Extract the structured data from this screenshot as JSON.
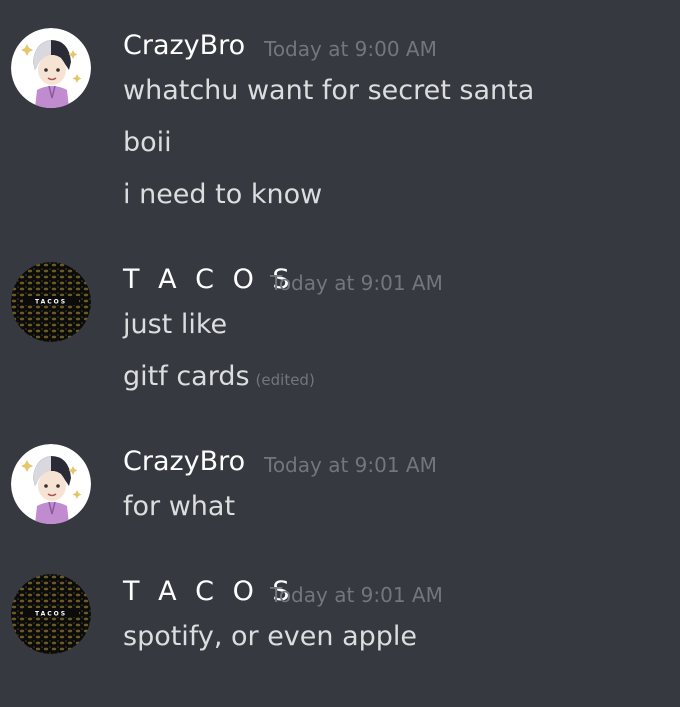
{
  "messages": [
    {
      "author": "CrazyBro",
      "timestamp": "Today at 9:00 AM",
      "lines": [
        {
          "text": "whatchu want for secret santa"
        },
        {
          "text": "boii"
        },
        {
          "text": "i need to know"
        }
      ]
    },
    {
      "author": "T A C O S",
      "timestamp": "Today at 9:01 AM",
      "lines": [
        {
          "text": "just like"
        },
        {
          "text": "gitf cards",
          "edited": "(edited)"
        }
      ]
    },
    {
      "author": "CrazyBro",
      "timestamp": "Today at 9:01 AM",
      "lines": [
        {
          "text": "for what"
        }
      ]
    },
    {
      "author": "T A C O S",
      "timestamp": "Today at 9:01 AM",
      "lines": [
        {
          "text": "spotify, or even apple"
        }
      ]
    }
  ],
  "avatars": {
    "crazybro": {
      "icon": "anime-character-avatar-icon"
    },
    "tacos": {
      "icon": "tacos-logo-avatar-icon",
      "logo_text": "TACOS"
    }
  }
}
